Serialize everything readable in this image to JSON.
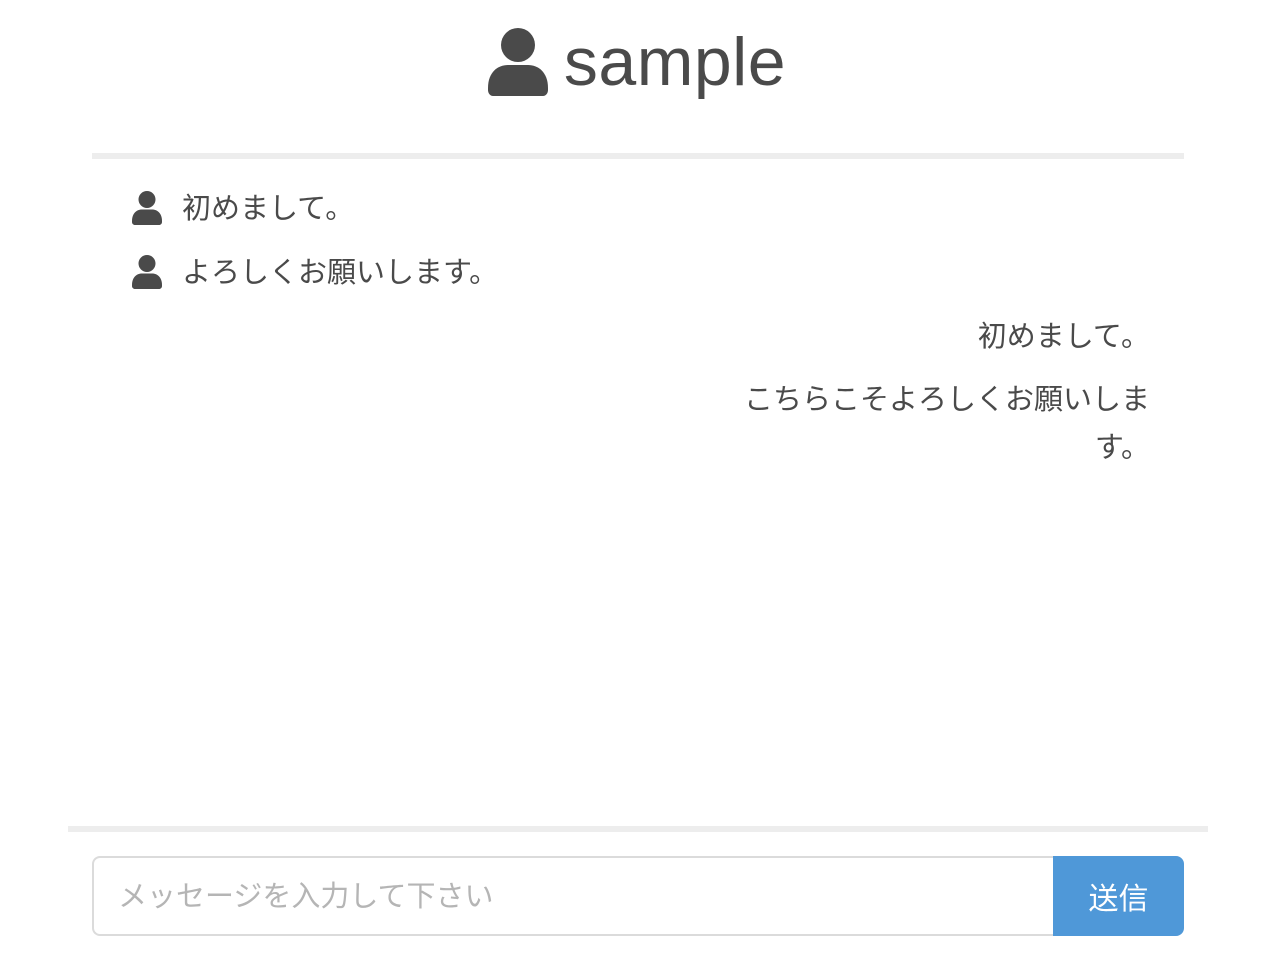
{
  "header": {
    "title": "sample",
    "icon": "user-icon"
  },
  "messages": {
    "incoming": [
      {
        "text": "初めまして。",
        "icon": "user-icon"
      },
      {
        "text": "よろしくお願いします。",
        "icon": "user-icon"
      }
    ],
    "outgoing": [
      {
        "text": "初めまして。"
      },
      {
        "text_line1": "こちらこそよろしくお願いしま",
        "text_line2": "す。"
      }
    ]
  },
  "composer": {
    "placeholder": "メッセージを入力して下さい",
    "value": "",
    "send_label": "送信"
  },
  "colors": {
    "text": "#4a4a4a",
    "accent": "#4f98d8",
    "divider": "#ededed",
    "placeholder": "#b5b5b5"
  }
}
